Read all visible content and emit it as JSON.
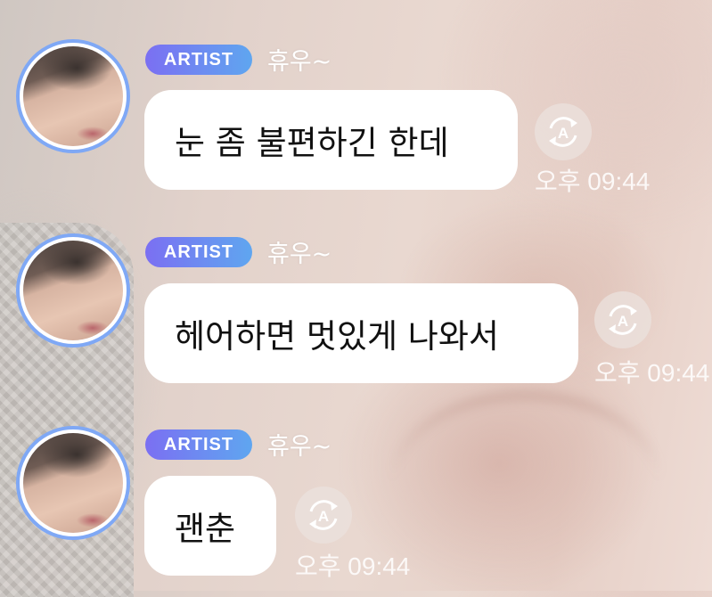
{
  "messages": [
    {
      "badge": "ARTIST",
      "name": "휴우~",
      "text": "눈 좀 불편하긴 한데",
      "time": "오후 09:44"
    },
    {
      "badge": "ARTIST",
      "name": "휴우~",
      "text": "헤어하면 멋있게 나와서",
      "time": "오후 09:44"
    },
    {
      "badge": "ARTIST",
      "name": "휴우~",
      "text": "괜춘",
      "time": "오후 09:44"
    }
  ],
  "colors": {
    "badge_start": "#7b6ff2",
    "badge_end": "#5fa6f0",
    "avatar_ring": "#7fa8f5",
    "bubble": "#ffffff"
  },
  "icons": {
    "translate": "translate-icon"
  }
}
